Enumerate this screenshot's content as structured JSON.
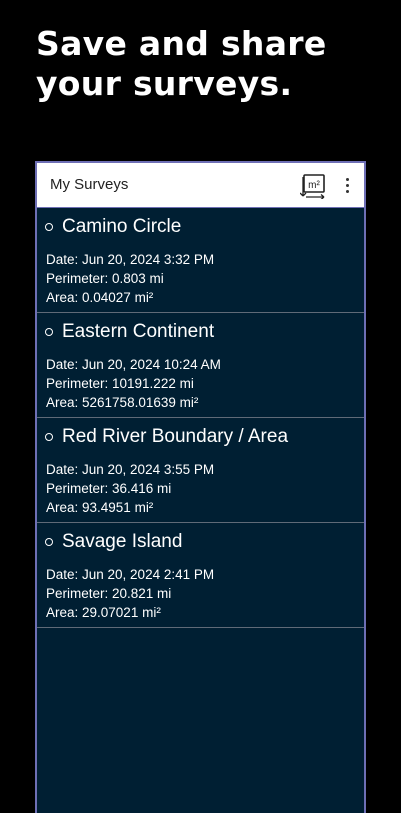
{
  "promo": {
    "line1": "Save and share",
    "line2": "your surveys."
  },
  "appbar": {
    "title": "My Surveys",
    "unit_toggle_label": "m²",
    "more_icon": "more-vert-icon"
  },
  "surveys": [
    {
      "name": "Camino Circle",
      "date": "Date: Jun 20, 2024 3:32 PM",
      "perimeter": "Perimeter: 0.803 mi",
      "area": "Area: 0.04027 mi²"
    },
    {
      "name": "Eastern Continent",
      "date": "Date: Jun 20, 2024 10:24 AM",
      "perimeter": "Perimeter: 10191.222 mi",
      "area": "Area: 5261758.01639 mi²"
    },
    {
      "name": "Red River Boundary / Area",
      "date": "Date: Jun 20, 2024 3:55 PM",
      "perimeter": "Perimeter: 36.416 mi",
      "area": "Area: 93.4951 mi²"
    },
    {
      "name": "Savage Island",
      "date": "Date: Jun 20, 2024 2:41 PM",
      "perimeter": "Perimeter: 20.821 mi",
      "area": "Area: 29.07021 mi²"
    }
  ],
  "colors": {
    "background": "#000000",
    "list_background": "#001f33",
    "frame_border": "#6e6fb5",
    "appbar": "#ffffff"
  }
}
